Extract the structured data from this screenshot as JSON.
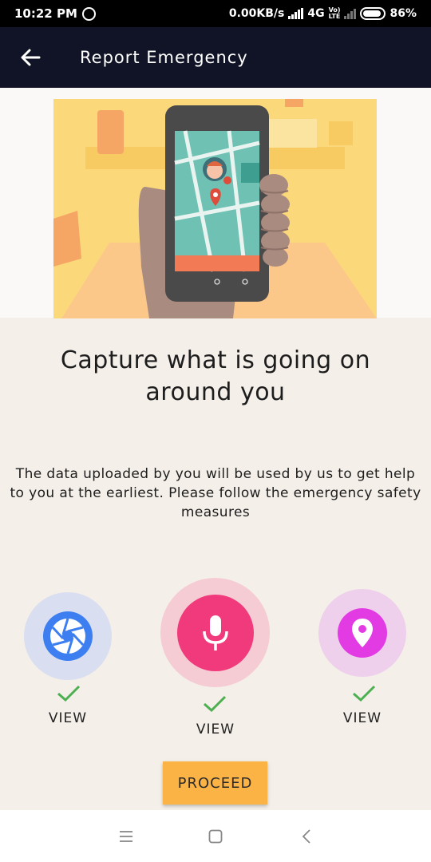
{
  "status_bar": {
    "time": "10:22 PM",
    "network_speed": "0.00KB/s",
    "network_type": "4G",
    "volte_top": "Vo)",
    "volte_bottom": "LTE",
    "battery": "86%"
  },
  "app_bar": {
    "title": "Report Emergency",
    "back_icon": "arrow-back-icon"
  },
  "main": {
    "headline": "Capture what is going on around you",
    "description": "The data uploaded by you will be used by us to get help to you at the earliest. Please follow the emergency safety measures",
    "actions": [
      {
        "name": "camera",
        "icon": "camera-aperture-icon",
        "status": "check-icon",
        "view_label": "VIEW",
        "color": "#3d7ff0",
        "halo": "#d9dff0"
      },
      {
        "name": "audio",
        "icon": "microphone-icon",
        "status": "check-icon",
        "view_label": "VIEW",
        "color": "#f03a7b",
        "halo": "#f6ccd4"
      },
      {
        "name": "location",
        "icon": "location-pin-icon",
        "status": "check-icon",
        "view_label": "VIEW",
        "color": "#e33be4",
        "halo": "#efd0ec"
      }
    ],
    "proceed_label": "PROCEED"
  },
  "nav_bar": {
    "menu_icon": "menu-icon",
    "home_icon": "home-square-icon",
    "back_icon": "back-chevron-icon"
  },
  "colors": {
    "app_bar": "#111426",
    "background": "#f4efe9",
    "proceed": "#fbb346",
    "check": "#4caf50"
  }
}
